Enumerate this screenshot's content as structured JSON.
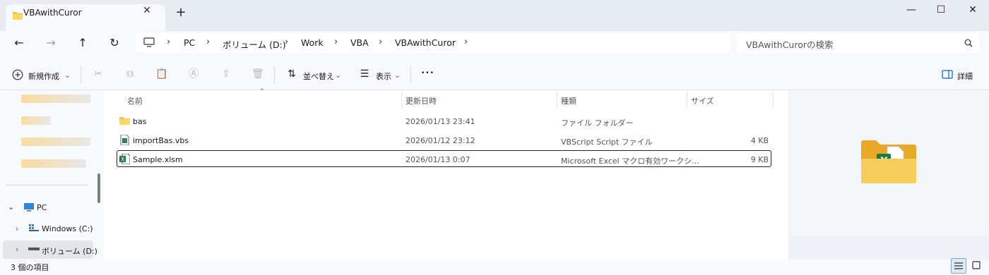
{
  "window": {
    "tab_title": "VBAwithCuror",
    "tab_close": "✕",
    "new_tab": "+",
    "minimize": "—",
    "maximize": "☐",
    "close": "✕"
  },
  "nav": {
    "back": "←",
    "forward": "→",
    "up": "↑",
    "refresh": "↻",
    "breadcrumb": [
      "PC",
      "ボリューム (D:)",
      "Work",
      "VBA",
      "VBAwithCuror"
    ],
    "search_placeholder": "VBAwithCurorの検索"
  },
  "toolbar": {
    "new_label": "新規作成",
    "sort_label": "並べ替え",
    "view_label": "表示",
    "more": "•••",
    "details_label": "詳細"
  },
  "sidebar": {
    "pc_label": "PC",
    "drives": [
      {
        "label": "Windows (C:)"
      },
      {
        "label": "ボリューム (D:)"
      }
    ]
  },
  "columns": {
    "name": "名前",
    "date": "更新日時",
    "type": "種類",
    "size": "サイズ"
  },
  "files": [
    {
      "name": "bas",
      "date": "2026/01/13 23:41",
      "type": "ファイル フォルダー",
      "size": ""
    },
    {
      "name": "importBas.vbs",
      "date": "2026/01/12 23:12",
      "type": "VBScript Script ファイル",
      "size": "4 KB"
    },
    {
      "name": "Sample.xlsm",
      "date": "2026/01/13 0:07",
      "type": "Microsoft Excel マクロ有効ワークシ...",
      "size": "9 KB"
    }
  ],
  "status": {
    "item_count": "3 個の項目"
  },
  "colors": {
    "accent": "#0067c0",
    "folder": "#f5c342",
    "excel": "#1d7a43"
  }
}
